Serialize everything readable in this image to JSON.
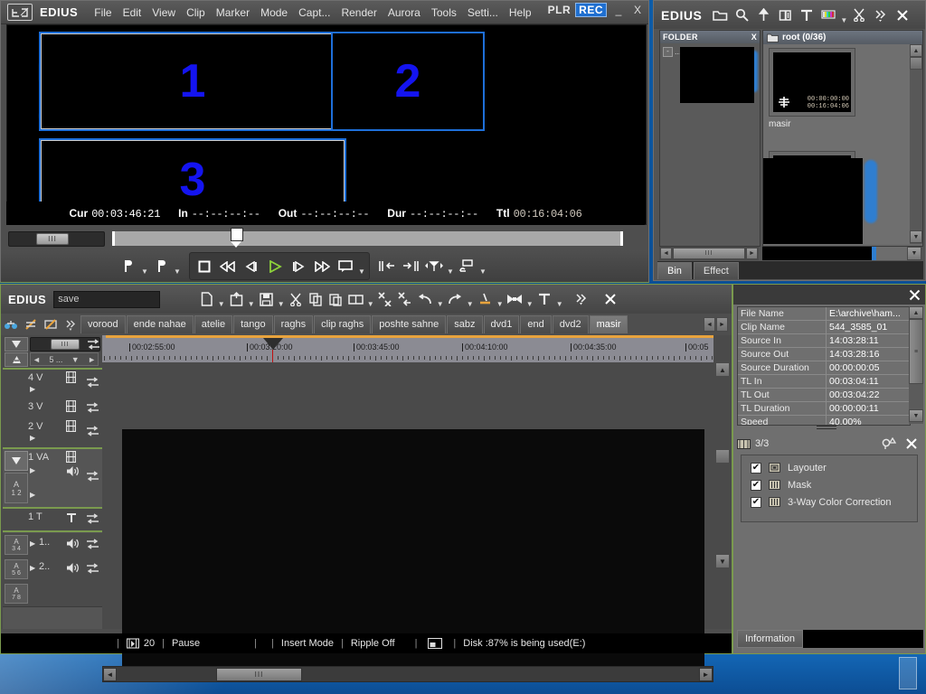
{
  "player": {
    "brand": "EDIUS",
    "logo": "G",
    "menus": [
      "File",
      "Edit",
      "View",
      "Clip",
      "Marker",
      "Mode",
      "Capt...",
      "Render",
      "Aurora",
      "Tools",
      "Setti...",
      "Help"
    ],
    "mode_plr": "PLR",
    "mode_rec": "REC",
    "minimize": "_",
    "close": "X",
    "monitor_layout": [
      {
        "num": "1"
      },
      {
        "num": "2"
      },
      {
        "num": "3"
      }
    ],
    "timecodes": [
      {
        "label": "Cur",
        "value": "00:03:46:21",
        "bright": true
      },
      {
        "label": "In",
        "value": "--:--:--:--",
        "bright": true
      },
      {
        "label": "Out",
        "value": "--:--:--:--",
        "bright": true
      },
      {
        "label": "Dur",
        "value": "--:--:--:--",
        "bright": true
      },
      {
        "label": "Ttl",
        "value": "00:16:04:06",
        "bright": false
      }
    ],
    "transport": {
      "mark_in": "mark-in-icon",
      "mark_out": "mark-out-icon",
      "stop": "stop-icon",
      "rewind": "rewind-icon",
      "prev_frame": "previous-frame-icon",
      "play": "play-icon",
      "next_frame": "next-frame-icon",
      "fast_forward": "fast-forward-icon",
      "loop": "loop-icon",
      "set_in": "set-in-icon",
      "set_out": "set-out-icon",
      "add_marker": "add-marker-icon",
      "export": "export-icon"
    }
  },
  "bin": {
    "brand": "EDIUS",
    "toolbar_icons": [
      "new-folder-icon",
      "search-icon",
      "up-folder-icon",
      "add-clip-icon",
      "title-icon",
      "color-bar-icon",
      "cut-icon",
      "more-icon",
      "close-icon"
    ],
    "folder": {
      "title": "FOLDER",
      "close": "X",
      "expand": "-",
      "ellipsis": "..."
    },
    "root": {
      "label": "root (0/36)",
      "folder_icon": "folder-icon"
    },
    "items": [
      {
        "name": "masir",
        "tc_in": "00:00:00:00",
        "tc_dur": "00:16:04:06"
      },
      {
        "name": "",
        "tc_in": "",
        "tc_dur": ""
      }
    ],
    "hscroll": {
      "left": "◄",
      "thumb": "III",
      "right": "►"
    },
    "tabs": [
      {
        "label": "Bin",
        "active": true
      },
      {
        "label": "Effect",
        "active": false
      }
    ]
  },
  "timeline": {
    "brand": "EDIUS",
    "sequence_name": "save",
    "close": "X",
    "toolbar_icons": [
      "new-sequence-icon",
      "open-project-icon",
      "save-project-icon",
      "cut-icon",
      "copy-icon",
      "paste-icon",
      "group-icon",
      "delete-gap-icon",
      "ripple-delete-icon",
      "undo-icon",
      "redo-icon",
      "razor-icon",
      "transition-icon",
      "title-icon",
      "more-icon",
      "close-icon"
    ],
    "mini_icons": [
      "track-link-icon",
      "ripple-mode-icon",
      "sync-lock-icon",
      "more-icon"
    ],
    "sequence_tabs": [
      {
        "label": "vorood",
        "active": false
      },
      {
        "label": "ende nahae",
        "active": false
      },
      {
        "label": "atelie",
        "active": false
      },
      {
        "label": "tango",
        "active": false
      },
      {
        "label": "raghs",
        "active": false
      },
      {
        "label": "clip raghs",
        "active": false
      },
      {
        "label": "poshte sahne",
        "active": false
      },
      {
        "label": "sabz",
        "active": false
      },
      {
        "label": "dvd1",
        "active": false
      },
      {
        "label": "end",
        "active": false
      },
      {
        "label": "dvd2",
        "active": false
      },
      {
        "label": "masir",
        "active": true
      }
    ],
    "tabnav": {
      "prev": "◄",
      "next": "►"
    },
    "ruler_labels": [
      "00:02:55:00",
      "00:03:20:00",
      "00:03:45:00",
      "00:04:10:00",
      "00:04:35:00",
      "00:05"
    ],
    "header_top": {
      "v_btn": "V",
      "a_btn": "A",
      "slider_thumb": "III",
      "zoom_value": "5 ...",
      "zoom_left": "◄",
      "zoom_right": "►",
      "zoom_down": "▼"
    },
    "tracks": [
      {
        "name": "4 V",
        "type": "video",
        "kind_icon": "film-icon",
        "selected": false
      },
      {
        "name": "3 V",
        "type": "video",
        "kind_icon": "film-icon",
        "selected": false
      },
      {
        "name": "2 V",
        "type": "video",
        "kind_icon": "film-icon",
        "selected": false
      },
      {
        "name": "1 VA",
        "type": "video-audio",
        "kind_icon": "film-icon",
        "audio_icon": "speaker-icon",
        "selected": true,
        "channel_btn": "A",
        "channel_nums": "1 2"
      },
      {
        "name": "1 T",
        "type": "title",
        "kind_icon": "title-icon",
        "selected": false
      },
      {
        "name": "1..",
        "type": "audio",
        "audio_icon": "speaker-icon",
        "channel_btn": "A",
        "channel_nums": "3 4",
        "selected": false
      },
      {
        "name": "2..",
        "type": "audio",
        "audio_icon": "speaker-icon",
        "channel_btn": "A",
        "channel_nums": "5 6",
        "selected": false
      },
      {
        "name": "",
        "type": "audio",
        "channel_btn": "A",
        "channel_nums": "7 8",
        "selected": false
      }
    ],
    "hscroll": {
      "left": "◄",
      "thumb": "III",
      "right": "►"
    },
    "status": {
      "fps_icon": "render-icon",
      "fps": "20",
      "state": "Pause",
      "insert_mode": "Insert Mode",
      "ripple": "Ripple Off",
      "monitor_icon": "monitor-icon",
      "disk": "Disk :87% is being used(E:)"
    }
  },
  "info": {
    "close": "X",
    "properties": [
      {
        "key": "File Name",
        "value": "E:\\archive\\ham..."
      },
      {
        "key": "Clip Name",
        "value": "544_3585_01"
      },
      {
        "key": "Source In",
        "value": "14:03:28:11"
      },
      {
        "key": "Source Out",
        "value": "14:03:28:16"
      },
      {
        "key": "Source Duration",
        "value": "00:00:00:05"
      },
      {
        "key": "TL In",
        "value": "00:03:04:11"
      },
      {
        "key": "TL Out",
        "value": "00:03:04:22"
      },
      {
        "key": "TL Duration",
        "value": "00:00:00:11"
      },
      {
        "key": "Speed",
        "value": "40.00%"
      }
    ],
    "effects_header": {
      "count": "3/3",
      "list_icon": "filmstrip-icon",
      "toggle_icon": "shape-toggle-icon",
      "close": "X"
    },
    "effects": [
      {
        "checked": true,
        "name": "Layouter",
        "icon": "layouter-icon"
      },
      {
        "checked": true,
        "name": "Mask",
        "icon": "mask-icon"
      },
      {
        "checked": true,
        "name": "3-Way Color Correction",
        "icon": "color-correction-icon"
      }
    ],
    "tabs": [
      {
        "label": "Information",
        "active": true
      }
    ]
  },
  "colors": {
    "accent_green": "#7a9a4e",
    "accent_blue": "#1e6fd9",
    "rec_blue": "#1f6fd0",
    "playhead_red": "#c01010",
    "ruler_orange": "#e8a33d",
    "panel_gray": "#545454",
    "desktop_blue": "#0c4d93"
  }
}
